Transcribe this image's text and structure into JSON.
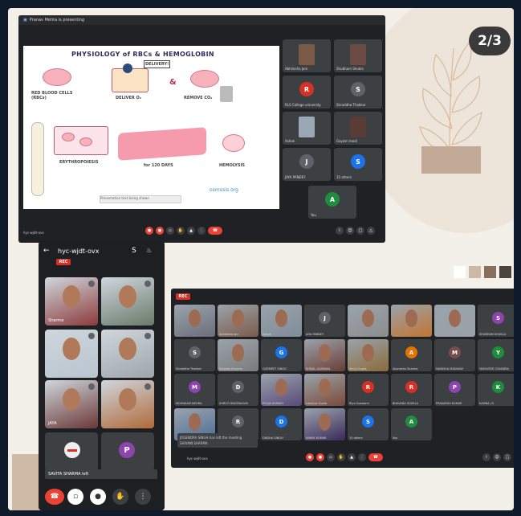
{
  "page_indicator": "2/3",
  "colors": {
    "frame_bg": "#f3efe9",
    "meet_dark": "#202124",
    "tile": "#3c4043",
    "end_call": "#ea4335",
    "swatches": [
      "#ffffff",
      "#cdb8a3",
      "#8a6f5d",
      "#4a4340"
    ]
  },
  "screenshot1": {
    "top_bar": "Pranav Mehta is presenting",
    "slide": {
      "title": "PHYSIOLOGY of RBCs & HEMOGLOBIN",
      "labels": {
        "red_blood_cells": "RED BLOOD CELLS (RBCs)",
        "deliver": "DELIVER O₂",
        "delivery_tag": "DELIVERY!",
        "remove": "REMOVE CO₂",
        "erythropoiesis": "ERYTHROPOIESIS",
        "days": "for 120 DAYS",
        "hemolysis": "HEMOLYSIS"
      },
      "brand": "osmosis.org",
      "caption": "Presentation text being shown"
    },
    "participants": [
      {
        "name": "Abhilasha Jain",
        "type": "photo",
        "color": "#7b5a48"
      },
      {
        "name": "Shubham Shukla",
        "type": "photo",
        "color": "#6b4c44"
      },
      {
        "name": "RLS College university",
        "type": "avatar",
        "initial": "R",
        "color": "#d93025"
      },
      {
        "name": "Shraddha Thakkar",
        "type": "avatar",
        "initial": "S",
        "color": "#5f6368"
      },
      {
        "name": "Ashok",
        "type": "photo",
        "color": "#9aa7b4"
      },
      {
        "name": "Gayatri modi",
        "type": "photo",
        "color": "#5a3c36"
      },
      {
        "name": "JAYA PANDEY",
        "type": "avatar",
        "initial": "J",
        "color": "#5f6368"
      },
      {
        "name": "15 others",
        "type": "group",
        "initial": "S",
        "color": "#1a73e8"
      },
      {
        "name": "You",
        "type": "avatar",
        "initial": "A",
        "color": "#1e8e3e"
      }
    ],
    "meeting_code": "hyc-wjdt-ovx"
  },
  "phone": {
    "meeting_code": "hyc-wjdt-ovx",
    "rec_label": "REC",
    "tiles": [
      {
        "name": "Sharma",
        "color": "#8c3b3b"
      },
      {
        "name": "",
        "color": "#6a7a6a"
      },
      {
        "name": "",
        "color": "#b9c4cf"
      },
      {
        "name": "",
        "color": "#9ea5ab"
      },
      {
        "name": "JAYA",
        "color": "#6b3838"
      },
      {
        "name": "",
        "color": "#b06a3a"
      }
    ],
    "avatar_p": "P",
    "caption": "SAVITA SHARMA left"
  },
  "screenshot3": {
    "rec_label": "REC",
    "tiles": [
      {
        "name": "",
        "type": "photo",
        "color": "#6a6f7a"
      },
      {
        "name": "Abhilasha Jain",
        "type": "photo",
        "color": "#7d5a4b"
      },
      {
        "name": "Ashok",
        "type": "photo",
        "color": "#7f8c98"
      },
      {
        "name": "JAYA PANDEY",
        "type": "avatar",
        "initial": "J",
        "color": "#5f6368"
      },
      {
        "name": "",
        "type": "photo",
        "color": "#8d8d8d"
      },
      {
        "name": "",
        "type": "photo",
        "color": "#c17530"
      },
      {
        "name": "",
        "type": "photo",
        "color": "#9aa0a6"
      },
      {
        "name": "SHUBHAM SHUKLA",
        "type": "avatar",
        "initial": "S",
        "color": "#8e44ad"
      },
      {
        "name": "Shraddha Thakkar",
        "type": "avatar",
        "initial": "S",
        "color": "#5f6368"
      },
      {
        "name": "Radhika Sharma",
        "type": "photo",
        "color": "#7b7b7b"
      },
      {
        "name": "GURMEET SINGH",
        "type": "avatar",
        "initial": "G",
        "color": "#1a73e8"
      },
      {
        "name": "SHEJAL AGARWAL",
        "type": "photo",
        "color": "#6b3d36"
      },
      {
        "name": "Vinny Gupta",
        "type": "photo",
        "color": "#8a6b3a"
      },
      {
        "name": "Akanksha Sharma",
        "type": "avatar",
        "initial": "A",
        "color": "#e37400"
      },
      {
        "name": "MANISHA MADHAW",
        "type": "avatar",
        "initial": "M",
        "color": "#7a4d4d"
      },
      {
        "name": "YASHVEER CHANDRA",
        "type": "avatar",
        "initial": "Y",
        "color": "#1e8e3e"
      },
      {
        "name": "MOHNAAM MEHRA",
        "type": "avatar",
        "initial": "M",
        "color": "#8e44ad"
      },
      {
        "name": "SHRUTI BHATNAGAR",
        "type": "avatar",
        "initial": "D",
        "color": "#5f6368"
      },
      {
        "name": "POOJA KUMARI",
        "type": "photo",
        "color": "#5a4a7a"
      },
      {
        "name": "Lakshya Gupta",
        "type": "photo",
        "color": "#7a4a3a"
      },
      {
        "name": "Riya Goswami",
        "type": "avatar",
        "initial": "R",
        "color": "#d93025"
      },
      {
        "name": "BHAVANA SHUKLA",
        "type": "avatar",
        "initial": "R",
        "color": "#d93025"
      },
      {
        "name": "PRAKARSH KUMAR",
        "type": "avatar",
        "initial": "P",
        "color": "#8e44ad"
      },
      {
        "name": "KAMNA J.S",
        "type": "avatar",
        "initial": "K",
        "color": "#1e8e3e"
      },
      {
        "name": "",
        "type": "photo",
        "color": "#4d6e99"
      },
      {
        "name": "Rudrapant Jain",
        "type": "avatar",
        "initial": "R",
        "color": "#5f6368"
      },
      {
        "name": "DIKSHA SINGH",
        "type": "avatar",
        "initial": "D",
        "color": "#1a73e8"
      },
      {
        "name": "ABHAY KUMAR",
        "type": "photo",
        "color": "#3a2a5a"
      },
      {
        "name": "15 others",
        "type": "group",
        "initial": "S",
        "color": "#1a73e8"
      },
      {
        "name": "You",
        "type": "avatar",
        "initial": "A",
        "color": "#1e8e3e"
      }
    ],
    "notifications": [
      "JOGENDRA SINGH has left the meeting",
      "SHIVANI SHARMA"
    ],
    "meeting_code": "hyc-wjdt-ovx"
  }
}
